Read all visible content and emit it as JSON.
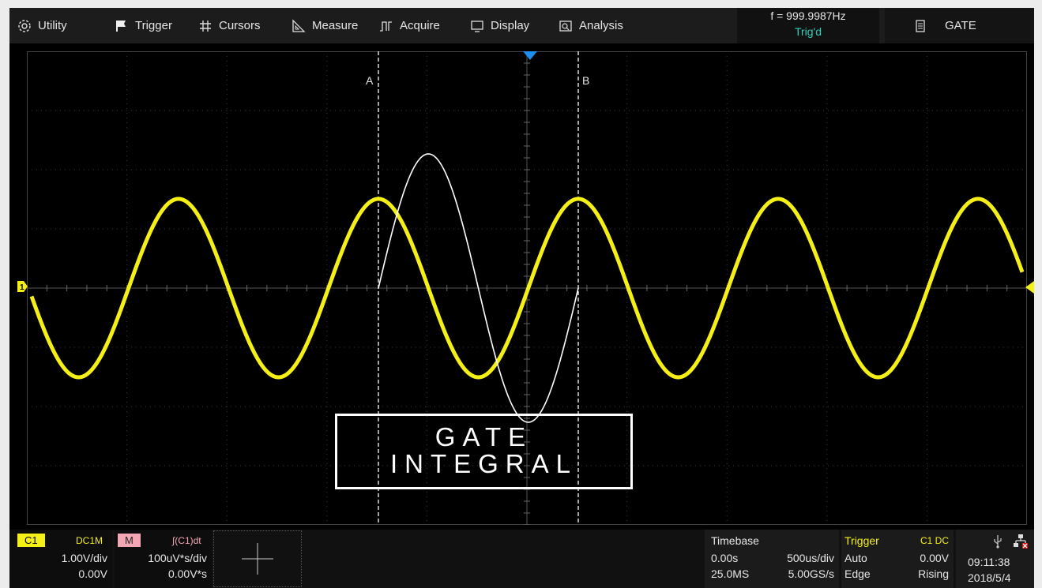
{
  "menu": {
    "items": [
      {
        "label": "Utility",
        "icon": "gear-icon"
      },
      {
        "label": "Trigger",
        "icon": "flag-icon"
      },
      {
        "label": "Cursors",
        "icon": "hash-icon"
      },
      {
        "label": "Measure",
        "icon": "ruler-triangle-icon"
      },
      {
        "label": "Acquire",
        "icon": "pulse-icon"
      },
      {
        "label": "Display",
        "icon": "monitor-icon"
      },
      {
        "label": "Analysis",
        "icon": "analysis-icon"
      }
    ],
    "frequency": "f = 999.9987Hz",
    "trigger_status": "Trig'd",
    "mode": "GATE",
    "mode_icon": "document-icon"
  },
  "scope": {
    "cursor_a_label": "A",
    "cursor_b_label": "B",
    "overlay_line1": "GATE",
    "overlay_line2": "INTEGRAL",
    "ch1_marker": "1",
    "colors": {
      "ch1": "#f5ef18",
      "math": "#ffffff",
      "grid": "#3a3a3a",
      "trigger_marker": "#1e8ef0"
    }
  },
  "bottom": {
    "c1": {
      "tag": "C1",
      "coupling": "DC1M",
      "scale": "1.00V/div",
      "offset": "0.00V"
    },
    "math": {
      "tag": "M",
      "function": "∫(C1)dt",
      "scale": "100uV*s/div",
      "offset": "0.00V*s"
    },
    "timebase": {
      "title": "Timebase",
      "delay": "0.00s",
      "scale": "500us/div",
      "mem_depth": "25.0MS",
      "sample_rate": "5.00GS/s"
    },
    "trigger": {
      "title": "Trigger",
      "source": "C1 DC",
      "mode": "Auto",
      "level": "0.00V",
      "type": "Edge",
      "slope": "Rising"
    },
    "clock": {
      "time": "09:11:38",
      "date": "2018/5/4",
      "usb_icon": "usb-icon",
      "network_icon": "network-error-icon"
    }
  }
}
